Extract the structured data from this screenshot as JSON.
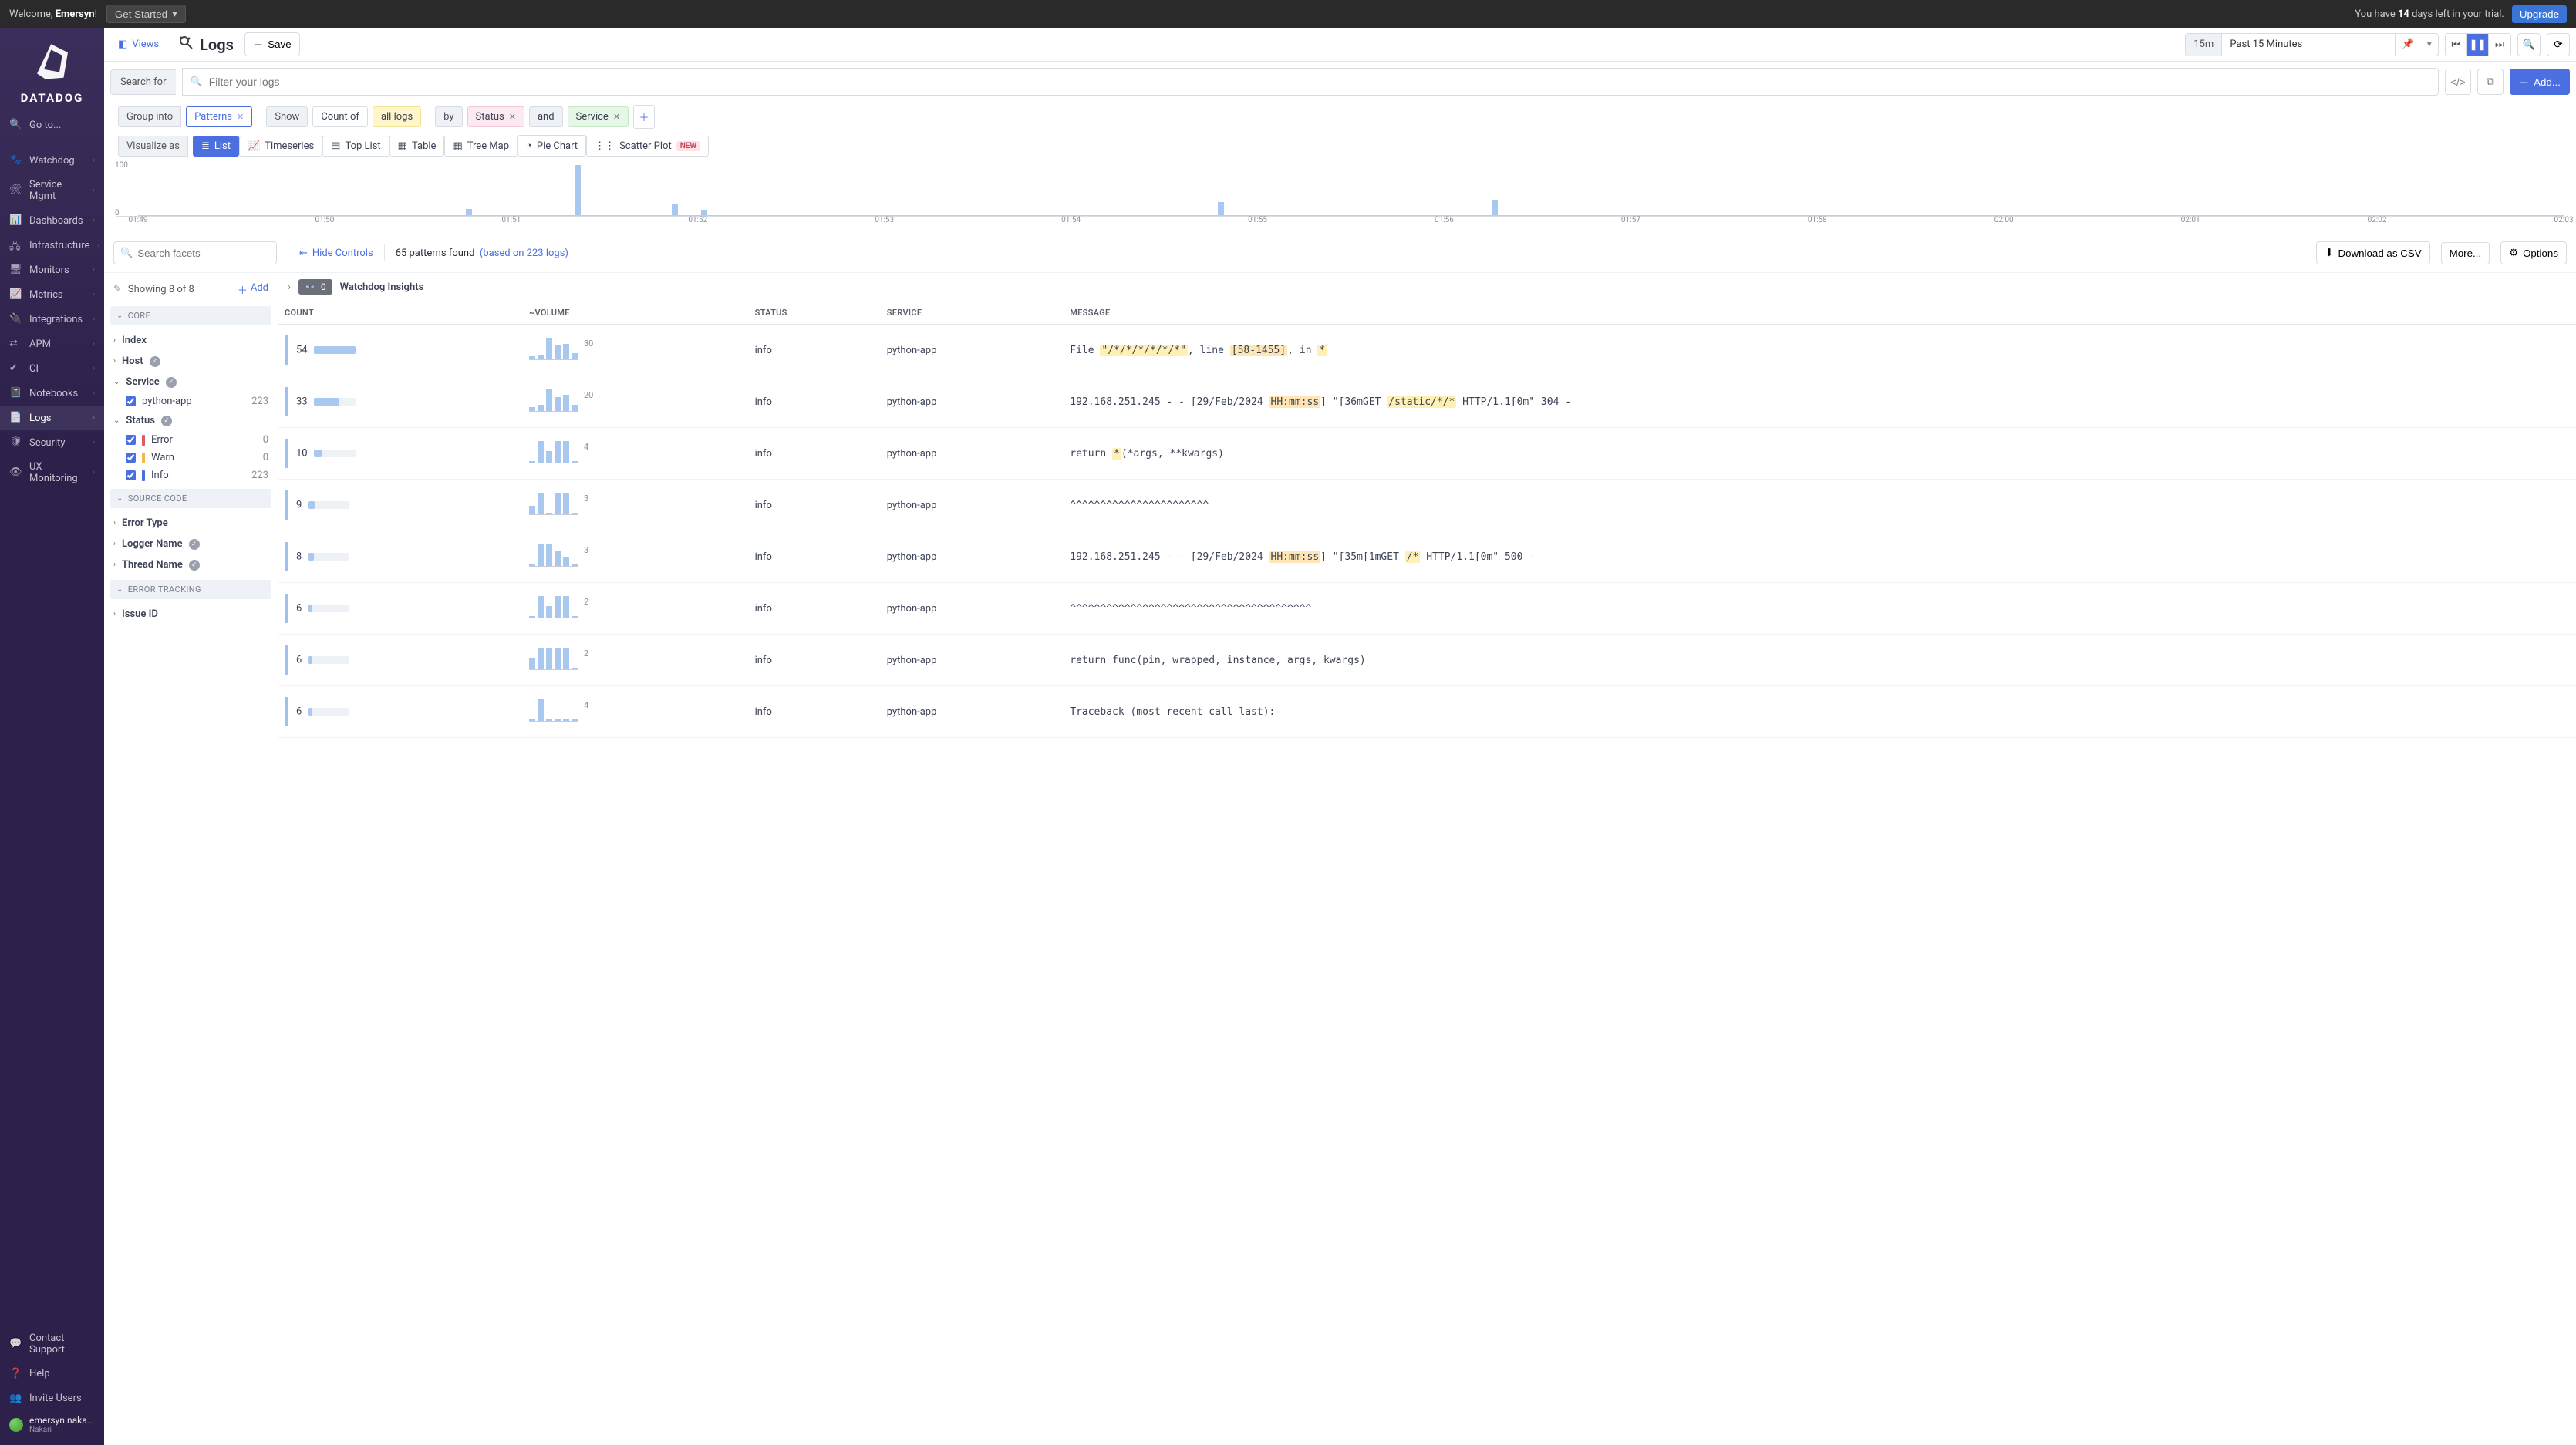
{
  "colors": {
    "accent": "#4b6fe0",
    "chartBar": "#a9c8f0"
  },
  "topbar": {
    "welcome_prefix": "Welcome, ",
    "welcome_name": "Emersyn",
    "welcome_suffix": "!",
    "get_started": "Get Started",
    "trial_prefix": "You have ",
    "trial_days": "14",
    "trial_suffix": " days left in your trial.",
    "upgrade": "Upgrade"
  },
  "brand": "DATADOG",
  "nav": {
    "goto": "Go to...",
    "items": [
      "Watchdog",
      "Service Mgmt",
      "Dashboards",
      "Infrastructure",
      "Monitors",
      "Metrics",
      "Integrations",
      "APM",
      "CI",
      "Notebooks",
      "Logs",
      "Security",
      "UX Monitoring"
    ],
    "active_index": 10,
    "bottom": [
      "Contact Support",
      "Help",
      "Invite Users"
    ],
    "user_name": "emersyn.naka...",
    "user_org": "Nakari"
  },
  "header": {
    "views": "Views",
    "title": "Logs",
    "save": "Save",
    "time_tag": "15m",
    "time_label": "Past 15 Minutes",
    "add": "Add..."
  },
  "search": {
    "label": "Search for",
    "placeholder": "Filter your logs"
  },
  "group_row": {
    "group_into": "Group into",
    "patterns": "Patterns",
    "show": "Show",
    "count_of": "Count of",
    "all_logs": "all logs",
    "by": "by",
    "status": "Status",
    "and": "and",
    "service": "Service"
  },
  "viz_row": {
    "label": "Visualize as",
    "options": [
      "List",
      "Timeseries",
      "Top List",
      "Table",
      "Tree Map",
      "Pie Chart",
      "Scatter Plot"
    ],
    "active_index": 0,
    "new_tag": "NEW"
  },
  "chart_data": {
    "type": "bar",
    "ylim": [
      0,
      100
    ],
    "ytick_labels": [
      "0",
      "100"
    ],
    "x_ticks": [
      "01:49",
      "01:50",
      "01:51",
      "01:52",
      "01:53",
      "01:54",
      "01:55",
      "01:56",
      "01:57",
      "01:58",
      "02:00",
      "02:01",
      "02:02",
      "02:03"
    ],
    "bars": [
      {
        "x_pct": 13.5,
        "value": 12
      },
      {
        "x_pct": 18.0,
        "value": 95
      },
      {
        "x_pct": 22.0,
        "value": 22
      },
      {
        "x_pct": 23.2,
        "value": 10
      },
      {
        "x_pct": 44.5,
        "value": 25
      },
      {
        "x_pct": 55.8,
        "value": 30
      }
    ]
  },
  "controls": {
    "facet_search_placeholder": "Search facets",
    "hide_controls": "Hide Controls",
    "patterns_found": "65 patterns found",
    "based_on": "(based on 223 logs)",
    "download_csv": "Download as CSV",
    "more": "More...",
    "options": "Options"
  },
  "facets": {
    "showing": "Showing 8 of 8",
    "add": "Add",
    "groups": [
      {
        "header": "CORE",
        "items": [
          {
            "label": "Index",
            "values": []
          },
          {
            "label": "Host",
            "verified": true,
            "values": []
          },
          {
            "label": "Service",
            "verified": true,
            "open": true,
            "values": [
              {
                "label": "python-app",
                "count": "223",
                "checked": true
              }
            ]
          },
          {
            "label": "Status",
            "verified": true,
            "open": true,
            "values": [
              {
                "label": "Error",
                "count": "0",
                "checked": true,
                "dot": "err"
              },
              {
                "label": "Warn",
                "count": "0",
                "checked": true,
                "dot": "warn"
              },
              {
                "label": "Info",
                "count": "223",
                "checked": true,
                "dot": "info"
              }
            ]
          }
        ]
      },
      {
        "header": "SOURCE CODE",
        "items": [
          {
            "label": "Error Type",
            "values": []
          },
          {
            "label": "Logger Name",
            "verified": true,
            "values": []
          },
          {
            "label": "Thread Name",
            "verified": true,
            "values": []
          }
        ]
      },
      {
        "header": "ERROR TRACKING",
        "items": [
          {
            "label": "Issue ID",
            "values": []
          }
        ]
      }
    ]
  },
  "insights": {
    "count": "0",
    "title": "Watchdog Insights"
  },
  "table": {
    "headers": [
      "COUNT",
      "~VOLUME",
      "STATUS",
      "SERVICE",
      "MESSAGE"
    ],
    "rows": [
      {
        "count": "54",
        "count_pct": 100,
        "spark_max": "30",
        "spark": [
          2,
          4,
          30,
          18,
          20,
          6
        ],
        "status": "info",
        "service": "python-app",
        "message": [
          {
            "t": "File "
          },
          {
            "t": "\"/*/*/*/*/*/*\"",
            "cls": "hl-y"
          },
          {
            "t": ", line "
          },
          {
            "t": "[58-1455]",
            "cls": "hl-o"
          },
          {
            "t": ", in "
          },
          {
            "t": "*",
            "cls": "hl-y"
          }
        ]
      },
      {
        "count": "33",
        "count_pct": 61,
        "spark_max": "20",
        "spark": [
          2,
          4,
          20,
          12,
          14,
          4
        ],
        "status": "info",
        "service": "python-app",
        "message": [
          {
            "t": "192.168.251.245 - - [29/Feb/2024 "
          },
          {
            "t": "HH:mm:ss",
            "cls": "hl-o"
          },
          {
            "t": "] \"[36mGET "
          },
          {
            "t": "/static/*/*",
            "cls": "hl-y"
          },
          {
            "t": " HTTP/1.1[0m\" 304 -"
          }
        ]
      },
      {
        "count": "10",
        "count_pct": 19,
        "spark_max": "4",
        "spark": [
          0,
          4,
          2,
          4,
          4,
          0
        ],
        "status": "info",
        "service": "python-app",
        "message": [
          {
            "t": "return "
          },
          {
            "t": "*",
            "cls": "hl-y"
          },
          {
            "t": "(*args, **kwargs)"
          }
        ]
      },
      {
        "count": "9",
        "count_pct": 17,
        "spark_max": "3",
        "spark": [
          1,
          3,
          0,
          3,
          3,
          0
        ],
        "status": "info",
        "service": "python-app",
        "message": [
          {
            "t": "^^^^^^^^^^^^^^^^^^^^^^^"
          }
        ]
      },
      {
        "count": "8",
        "count_pct": 15,
        "spark_max": "3",
        "spark": [
          0,
          3,
          3,
          2,
          1,
          0
        ],
        "status": "info",
        "service": "python-app",
        "message": [
          {
            "t": "192.168.251.245 - - [29/Feb/2024 "
          },
          {
            "t": "HH:mm:ss",
            "cls": "hl-o"
          },
          {
            "t": "] \"[35m[1mGET "
          },
          {
            "t": "/*",
            "cls": "hl-y"
          },
          {
            "t": " HTTP/1.1[0m\" 500 -"
          }
        ]
      },
      {
        "count": "6",
        "count_pct": 11,
        "spark_max": "2",
        "spark": [
          0,
          2,
          1,
          2,
          2,
          0
        ],
        "status": "info",
        "service": "python-app",
        "message": [
          {
            "t": "^^^^^^^^^^^^^^^^^^^^^^^^^^^^^^^^^^^^^^^^"
          }
        ]
      },
      {
        "count": "6",
        "count_pct": 11,
        "spark_max": "2",
        "spark": [
          1,
          2,
          2,
          2,
          2,
          0
        ],
        "status": "info",
        "service": "python-app",
        "message": [
          {
            "t": "return func(pin, wrapped, instance, args, kwargs)"
          }
        ]
      },
      {
        "count": "6",
        "count_pct": 11,
        "spark_max": "4",
        "spark": [
          0,
          4,
          0,
          0,
          0,
          0
        ],
        "status": "info",
        "service": "python-app",
        "message": [
          {
            "t": "Traceback (most recent call last):"
          }
        ]
      }
    ]
  }
}
